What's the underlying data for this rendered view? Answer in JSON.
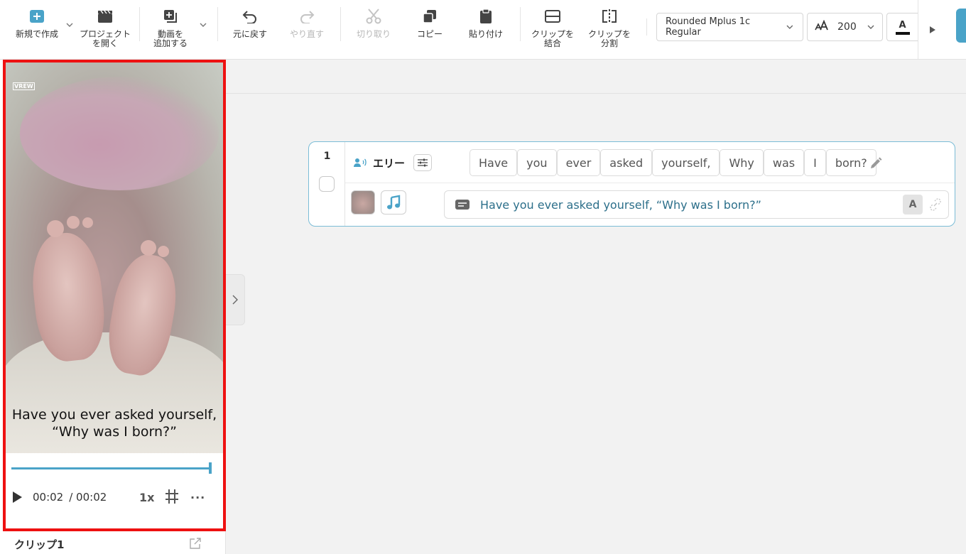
{
  "toolbar": {
    "new": "新規で作成",
    "open_project_line1": "プロジェクト",
    "open_project_line2": "を開く",
    "add_video_line1": "動画を",
    "add_video_line2": "追加する",
    "undo": "元に戻す",
    "redo": "やり直す",
    "cut": "切り取り",
    "copy": "コピー",
    "paste": "貼り付け",
    "merge_line1": "クリップを",
    "merge_line2": "結合",
    "split_line1": "クリップを",
    "split_line2": "分割",
    "font": "Rounded Mplus 1c Regular",
    "font_size": "200",
    "color_letter": "A"
  },
  "preview": {
    "watermark": "VREW",
    "subtitle_line1": "Have you ever asked yourself,",
    "subtitle_line2": "“Why was I born?”",
    "current_time": "00:02",
    "total_time": "/ 00:02",
    "speed": "1x",
    "more": "···",
    "clip_label": "クリップ1",
    "progress": 1.0
  },
  "clip": {
    "number": "1",
    "speaker": "エリー",
    "words": [
      "Have",
      "you",
      "ever",
      "asked",
      "yourself,",
      "Why",
      "was",
      "I",
      "born?"
    ],
    "subtitle": "Have you ever asked yourself, “Why was I born?”",
    "style_button": "A"
  },
  "colors": {
    "accent": "#4aa3c8",
    "highlight_frame": "#ee1111",
    "subtitle_text": "#2c6f8a"
  }
}
